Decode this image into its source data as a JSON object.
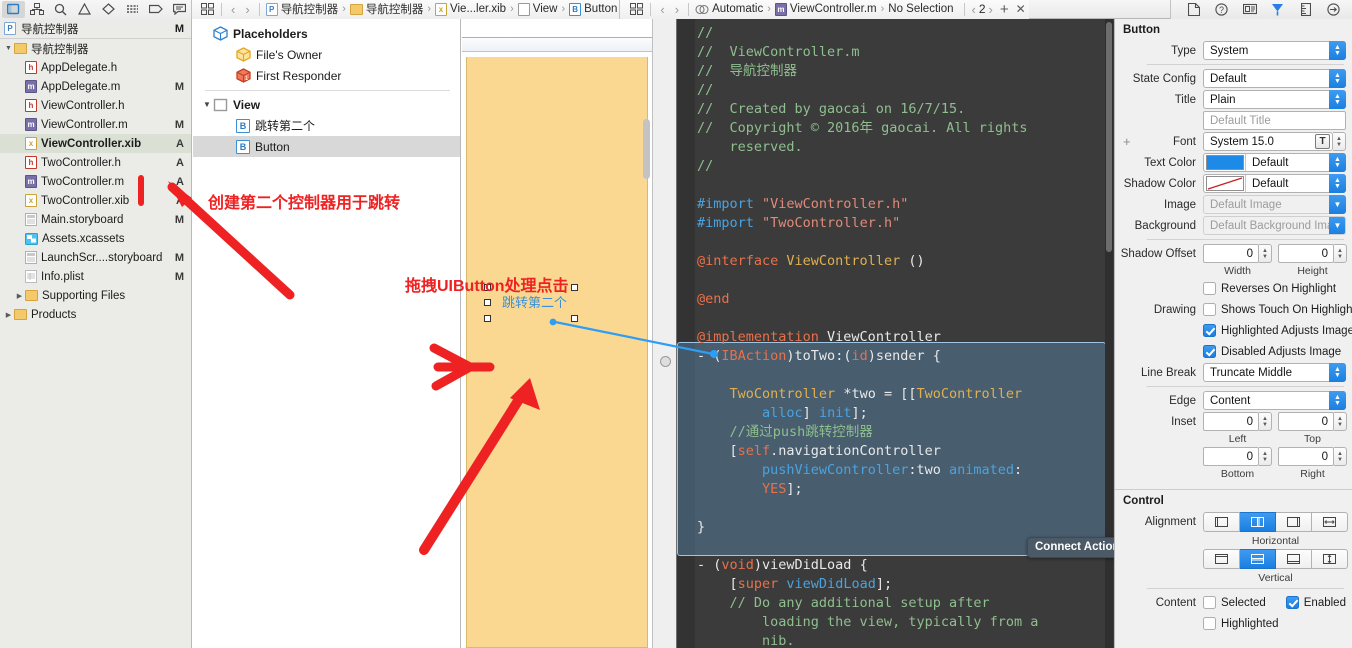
{
  "toolbar": {
    "left_icons": [
      "folder-icon",
      "hierarchy-icon",
      "search-icon",
      "warning-icon",
      "issue-icon",
      "debug-icon",
      "breakpoint-icon",
      "report-icon"
    ],
    "right_icons": [
      "file-inspector-icon",
      "quick-help-icon",
      "identity-inspector-icon",
      "attributes-inspector-icon",
      "size-inspector-icon",
      "connections-inspector-icon"
    ],
    "assistant_icon": "assistant-editor-icon",
    "counter": "2",
    "add_label": "+",
    "close_label": "✕"
  },
  "jumpbar": {
    "primary": [
      {
        "icon": "xib-icon",
        "label": "导航控制器"
      },
      {
        "icon": "folder-icon",
        "label": "导航控制器"
      },
      {
        "icon": "xib-icon",
        "label": "Vie...ler.xib"
      },
      {
        "icon": "view-icon",
        "label": "View"
      },
      {
        "icon": "button-icon",
        "label": "Button"
      }
    ],
    "secondary": [
      {
        "icon": "automatic-icon",
        "label": "Automatic"
      },
      {
        "icon": "m-file-icon",
        "label": "ViewController.m"
      },
      {
        "icon": "none",
        "label": "No Selection"
      }
    ]
  },
  "navigator": {
    "header": {
      "icon": "project-icon",
      "label": "导航控制器",
      "status": "M"
    },
    "items": [
      {
        "indent": 0,
        "twisty": "▼",
        "icon": "folder-icon",
        "label": "导航控制器",
        "status": "",
        "selected": false
      },
      {
        "indent": 1,
        "twisty": "",
        "icon": "h-file-icon",
        "label": "AppDelegate.h",
        "status": "",
        "selected": false
      },
      {
        "indent": 1,
        "twisty": "",
        "icon": "m-file-icon",
        "label": "AppDelegate.m",
        "status": "M",
        "selected": false
      },
      {
        "indent": 1,
        "twisty": "",
        "icon": "h-file-icon",
        "label": "ViewController.h",
        "status": "",
        "selected": false
      },
      {
        "indent": 1,
        "twisty": "",
        "icon": "m-file-icon",
        "label": "ViewController.m",
        "status": "M",
        "selected": false
      },
      {
        "indent": 1,
        "twisty": "",
        "icon": "xib-file-icon",
        "label": "ViewController.xib",
        "status": "A",
        "selected": true
      },
      {
        "indent": 1,
        "twisty": "",
        "icon": "h-file-icon",
        "label": "TwoController.h",
        "status": "A",
        "selected": false
      },
      {
        "indent": 1,
        "twisty": "",
        "icon": "m-file-icon",
        "label": "TwoController.m",
        "status": "A",
        "selected": false
      },
      {
        "indent": 1,
        "twisty": "",
        "icon": "xib-file-icon",
        "label": "TwoController.xib",
        "status": "A",
        "selected": false
      },
      {
        "indent": 1,
        "twisty": "",
        "icon": "storyboard-icon",
        "label": "Main.storyboard",
        "status": "M",
        "selected": false
      },
      {
        "indent": 1,
        "twisty": "",
        "icon": "assets-icon",
        "label": "Assets.xcassets",
        "status": "",
        "selected": false
      },
      {
        "indent": 1,
        "twisty": "",
        "icon": "storyboard-icon",
        "label": "LaunchScr....storyboard",
        "status": "M",
        "selected": false
      },
      {
        "indent": 1,
        "twisty": "",
        "icon": "plist-icon",
        "label": "Info.plist",
        "status": "M",
        "selected": false
      },
      {
        "indent": 1,
        "twisty": "▶",
        "icon": "folder-icon",
        "label": "Supporting Files",
        "status": "",
        "selected": false
      },
      {
        "indent": 0,
        "twisty": "▶",
        "icon": "folder-icon",
        "label": "Products",
        "status": "",
        "selected": false
      }
    ]
  },
  "outline": {
    "rows": [
      {
        "indent": 0,
        "twisty": "",
        "icon": "cube-blue-icon",
        "label": "Placeholders",
        "bold": true,
        "selected": false
      },
      {
        "indent": 1,
        "twisty": "",
        "icon": "cube-yellow-icon",
        "label": "File's Owner",
        "bold": false,
        "selected": false
      },
      {
        "indent": 1,
        "twisty": "",
        "icon": "cube-red-icon",
        "label": "First Responder",
        "bold": false,
        "selected": false
      },
      {
        "indent": 0,
        "twisty": "▼",
        "icon": "view-icon",
        "label": "View",
        "bold": true,
        "selected": false
      },
      {
        "indent": 1,
        "twisty": "",
        "icon": "button-icon",
        "label": "跳转第二个",
        "bold": false,
        "selected": false
      },
      {
        "indent": 1,
        "twisty": "",
        "icon": "button-icon",
        "label": "Button",
        "bold": false,
        "selected": true
      }
    ]
  },
  "canvas": {
    "button_label": "跳转第二个",
    "view_color": "#fad891"
  },
  "annotations": {
    "note1": "创建第二个控制器用于跳转",
    "note2": "拖拽UIButton处理点击",
    "color": "#ee2222"
  },
  "tooltip": {
    "label": "Connect Action"
  },
  "editor": {
    "lines": [
      [
        {
          "t": "//",
          "c": "c-cmt"
        }
      ],
      [
        {
          "t": "//  ViewController.m",
          "c": "c-cmt"
        }
      ],
      [
        {
          "t": "//  导航控制器",
          "c": "c-cmt"
        }
      ],
      [
        {
          "t": "//",
          "c": "c-cmt"
        }
      ],
      [
        {
          "t": "//  Created by gaocai on 16/7/15.",
          "c": "c-cmt"
        }
      ],
      [
        {
          "t": "//  Copyright © 2016年 gaocai. All rights",
          "c": "c-cmt"
        }
      ],
      [
        {
          "t": "    reserved.",
          "c": "c-cmt"
        }
      ],
      [
        {
          "t": "//",
          "c": "c-cmt"
        }
      ],
      [
        {
          "t": "",
          "c": "c-txt"
        }
      ],
      [
        {
          "t": "#import ",
          "c": "c-pre"
        },
        {
          "t": "\"ViewController.h\"",
          "c": "c-str"
        }
      ],
      [
        {
          "t": "#import ",
          "c": "c-pre"
        },
        {
          "t": "\"TwoController.h\"",
          "c": "c-str"
        }
      ],
      [
        {
          "t": "",
          "c": "c-txt"
        }
      ],
      [
        {
          "t": "@interface ",
          "c": "c-kw"
        },
        {
          "t": "ViewController ",
          "c": "c-type"
        },
        {
          "t": "()",
          "c": "c-txt"
        }
      ],
      [
        {
          "t": "",
          "c": "c-txt"
        }
      ],
      [
        {
          "t": "@end",
          "c": "c-kw"
        }
      ],
      [
        {
          "t": "",
          "c": "c-txt"
        }
      ],
      [
        {
          "t": "@implementation ",
          "c": "c-kw"
        },
        {
          "t": "ViewController",
          "c": "c-txt"
        }
      ],
      [
        {
          "t": "- (",
          "c": "c-txt"
        },
        {
          "t": "IBAction",
          "c": "c-kw"
        },
        {
          "t": ")toTwo:(",
          "c": "c-txt"
        },
        {
          "t": "id",
          "c": "c-kw"
        },
        {
          "t": ")sender {",
          "c": "c-txt"
        }
      ],
      [
        {
          "t": "",
          "c": "c-txt"
        }
      ],
      [
        {
          "t": "    ",
          "c": "c-txt"
        },
        {
          "t": "TwoController ",
          "c": "c-type"
        },
        {
          "t": "*two = [[",
          "c": "c-txt"
        },
        {
          "t": "TwoController",
          "c": "c-type"
        }
      ],
      [
        {
          "t": "        ",
          "c": "c-txt"
        },
        {
          "t": "alloc",
          "c": "c-sel"
        },
        {
          "t": "] ",
          "c": "c-txt"
        },
        {
          "t": "init",
          "c": "c-sel"
        },
        {
          "t": "];",
          "c": "c-txt"
        }
      ],
      [
        {
          "t": "    //通过push跳转控制器",
          "c": "c-cmt"
        }
      ],
      [
        {
          "t": "    [",
          "c": "c-txt"
        },
        {
          "t": "self",
          "c": "c-kw"
        },
        {
          "t": ".navigationController",
          "c": "c-txt"
        }
      ],
      [
        {
          "t": "        ",
          "c": "c-txt"
        },
        {
          "t": "pushViewController",
          "c": "c-sel"
        },
        {
          "t": ":two ",
          "c": "c-txt"
        },
        {
          "t": "animated",
          "c": "c-sel"
        },
        {
          "t": ":",
          "c": "c-txt"
        }
      ],
      [
        {
          "t": "        ",
          "c": "c-txt"
        },
        {
          "t": "YES",
          "c": "c-kw"
        },
        {
          "t": "];",
          "c": "c-txt"
        }
      ],
      [
        {
          "t": "",
          "c": "c-txt"
        }
      ],
      [
        {
          "t": "}",
          "c": "c-txt"
        }
      ],
      [
        {
          "t": "",
          "c": "c-txt"
        }
      ],
      [
        {
          "t": "- (",
          "c": "c-txt"
        },
        {
          "t": "void",
          "c": "c-kw"
        },
        {
          "t": ")viewDidLoad {",
          "c": "c-txt"
        }
      ],
      [
        {
          "t": "    [",
          "c": "c-txt"
        },
        {
          "t": "super ",
          "c": "c-kw"
        },
        {
          "t": "viewDidLoad",
          "c": "c-sel"
        },
        {
          "t": "];",
          "c": "c-txt"
        }
      ],
      [
        {
          "t": "    // Do any additional setup after",
          "c": "c-cmt"
        }
      ],
      [
        {
          "t": "        loading the view, typically from a",
          "c": "c-cmt"
        }
      ],
      [
        {
          "t": "        nib.",
          "c": "c-cmt"
        }
      ]
    ]
  },
  "inspector": {
    "button_section": {
      "title": "Button",
      "type_label": "Type",
      "type_value": "System",
      "state_config_label": "State Config",
      "state_config_value": "Default",
      "title_label": "Title",
      "title_value": "Plain",
      "title_text_placeholder": "Default Title",
      "font_label": "Font",
      "font_value": "System 15.0",
      "text_color_label": "Text Color",
      "text_color_value": "Default",
      "shadow_color_label": "Shadow Color",
      "shadow_color_value": "Default",
      "image_label": "Image",
      "image_value": "Default Image",
      "background_label": "Background",
      "background_value": "Default Background Imag",
      "shadow_offset_label": "Shadow Offset",
      "shadow_width": "0",
      "shadow_width_cap": "Width",
      "shadow_height": "0",
      "shadow_height_cap": "Height",
      "drawing_label": "Drawing",
      "drawing_options": [
        {
          "label": "Reverses On Highlight",
          "checked": false
        },
        {
          "label": "Shows Touch On Highligh",
          "checked": false
        },
        {
          "label": "Highlighted Adjusts Image",
          "checked": true
        },
        {
          "label": "Disabled Adjusts Image",
          "checked": true
        }
      ],
      "line_break_label": "Line Break",
      "line_break_value": "Truncate Middle",
      "edge_label": "Edge",
      "edge_value": "Content",
      "inset_label": "Inset",
      "inset_left": "0",
      "inset_left_cap": "Left",
      "inset_top": "0",
      "inset_top_cap": "Top",
      "inset_bottom": "0",
      "inset_bottom_cap": "Bottom",
      "inset_right": "0",
      "inset_right_cap": "Right"
    },
    "control_section": {
      "title": "Control",
      "alignment_label": "Alignment",
      "horizontal_caption": "Horizontal",
      "horizontal_selected_index": 1,
      "vertical_caption": "Vertical",
      "vertical_selected_index": 1,
      "content_label": "Content",
      "content_options": [
        {
          "label": "Selected",
          "checked": false
        },
        {
          "label": "Enabled",
          "checked": true
        },
        {
          "label": "Highlighted",
          "checked": false
        }
      ]
    }
  }
}
